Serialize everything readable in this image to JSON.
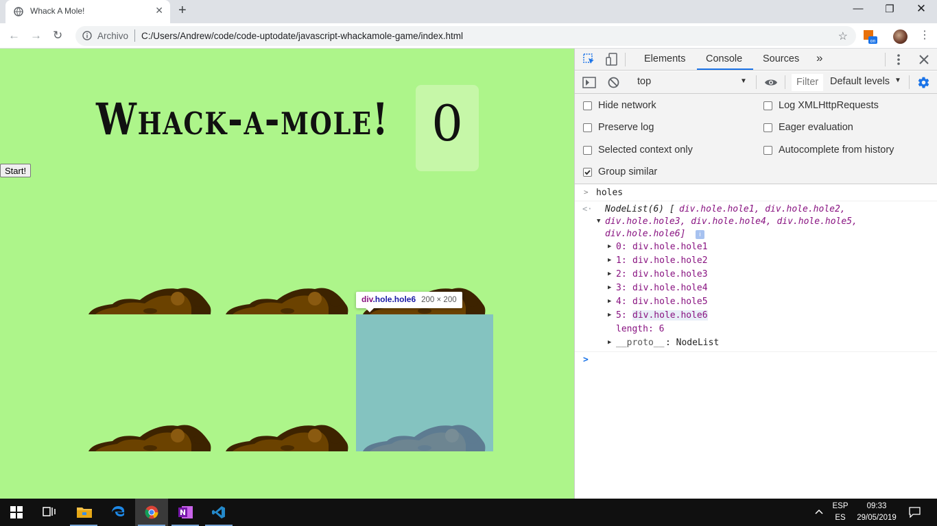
{
  "browser": {
    "tab_title": "Whack A Mole!",
    "tab_close": "✕",
    "new_tab": "+",
    "window_minimize": "—",
    "window_restore": "❐",
    "window_close": "✕",
    "nav_back": "←",
    "nav_forward": "→",
    "reload": "↻",
    "url_scheme": "Archivo",
    "url": "C:/Users/Andrew/code/code-uptodate/javascript-whackamole-game/index.html",
    "bookmark": "☆",
    "menu": "⋮",
    "extension_badge": "on"
  },
  "page": {
    "title": "Whack-a-mole!",
    "score": "0",
    "start_label": "Start!",
    "tooltip": {
      "tag": "div",
      "class": ".hole.hole6",
      "dims": "200 × 200"
    },
    "colors": {
      "background": "#adf58a",
      "dirt_dark": "#3d2300",
      "dirt": "#6b4200",
      "highlight": "#6fa8dc"
    }
  },
  "devtools": {
    "tabs": [
      "Elements",
      "Console",
      "Sources"
    ],
    "more_tabs": "»",
    "active_tab": "Console",
    "context": "top",
    "filter_placeholder": "Filter",
    "levels": "Default levels",
    "settings_left": [
      "Hide network",
      "Preserve log",
      "Selected context only",
      "Group similar"
    ],
    "settings_left_checked": [
      false,
      false,
      false,
      true
    ],
    "settings_right": [
      "Log XMLHttpRequests",
      "Eager evaluation",
      "Autocomplete from history"
    ],
    "console": {
      "input": "holes",
      "result_line1_a": "NodeList(6) [",
      "result_line1_b": "div.hole.hole1, div.hole.hole2,",
      "result_line2": "div.hole.hole3, div.hole.hole4, div.hole.hole5,",
      "result_line3": "div.hole.hole6]",
      "info_badge": "i",
      "entries": [
        {
          "key": "0:",
          "value": "div.hole.hole1"
        },
        {
          "key": "1:",
          "value": "div.hole.hole2"
        },
        {
          "key": "2:",
          "value": "div.hole.hole3"
        },
        {
          "key": "3:",
          "value": "div.hole.hole4"
        },
        {
          "key": "4:",
          "value": "div.hole.hole5"
        },
        {
          "key": "5:",
          "value": "div.hole.hole6"
        }
      ],
      "length_label": "length: 6",
      "proto_key": "__proto__",
      "proto_value": ": NodeList",
      "prompt": ">"
    }
  },
  "taskbar": {
    "language": "ESP",
    "region": "ES",
    "time": "09:33",
    "date": "29/05/2019"
  }
}
